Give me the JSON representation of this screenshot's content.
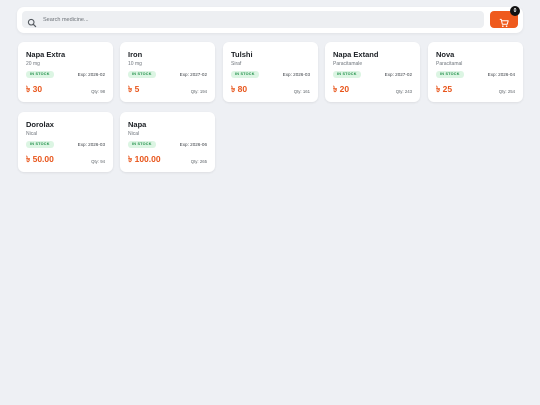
{
  "search": {
    "placeholder": "Search medicine...",
    "value": ""
  },
  "cart": {
    "count": "0"
  },
  "medicines": [
    {
      "name": "Napa Extra",
      "sub": "20 mg",
      "status": "IN STOCK",
      "exp": "Exp: 2026-02",
      "price": "৳ 30",
      "qty": "Qty: 98"
    },
    {
      "name": "Iron",
      "sub": "10 mg",
      "status": "IN STOCK",
      "exp": "Exp: 2027-02",
      "price": "৳ 5",
      "qty": "Qty: 194"
    },
    {
      "name": "Tulshi",
      "sub": "Siraf",
      "status": "IN STOCK",
      "exp": "Exp: 2026-03",
      "price": "৳ 80",
      "qty": "Qty: 161"
    },
    {
      "name": "Napa Extand",
      "sub": "Paracitamale",
      "status": "IN STOCK",
      "exp": "Exp: 2027-02",
      "price": "৳ 20",
      "qty": "Qty: 243"
    },
    {
      "name": "Nova",
      "sub": "Paracitamal",
      "status": "IN STOCK",
      "exp": "Exp: 2026-04",
      "price": "৳ 25",
      "qty": "Qty: 254"
    },
    {
      "name": "Dorolax",
      "sub": "Nical",
      "status": "IN STOCK",
      "exp": "Exp: 2026-03",
      "price": "৳ 50.00",
      "qty": "Qty: 94"
    },
    {
      "name": "Napa",
      "sub": "Nical",
      "status": "IN STOCK",
      "exp": "Exp: 2026-06",
      "price": "৳ 100.00",
      "qty": "Qty: 265"
    }
  ],
  "colors": {
    "accent": "#ef5a1d",
    "price": "#e8551b",
    "stock_bg": "#dcf5e3",
    "stock_text": "#1f8f48",
    "page_bg": "#eef0f4"
  },
  "icons": {
    "search": "search-icon",
    "cart": "cart-icon"
  }
}
